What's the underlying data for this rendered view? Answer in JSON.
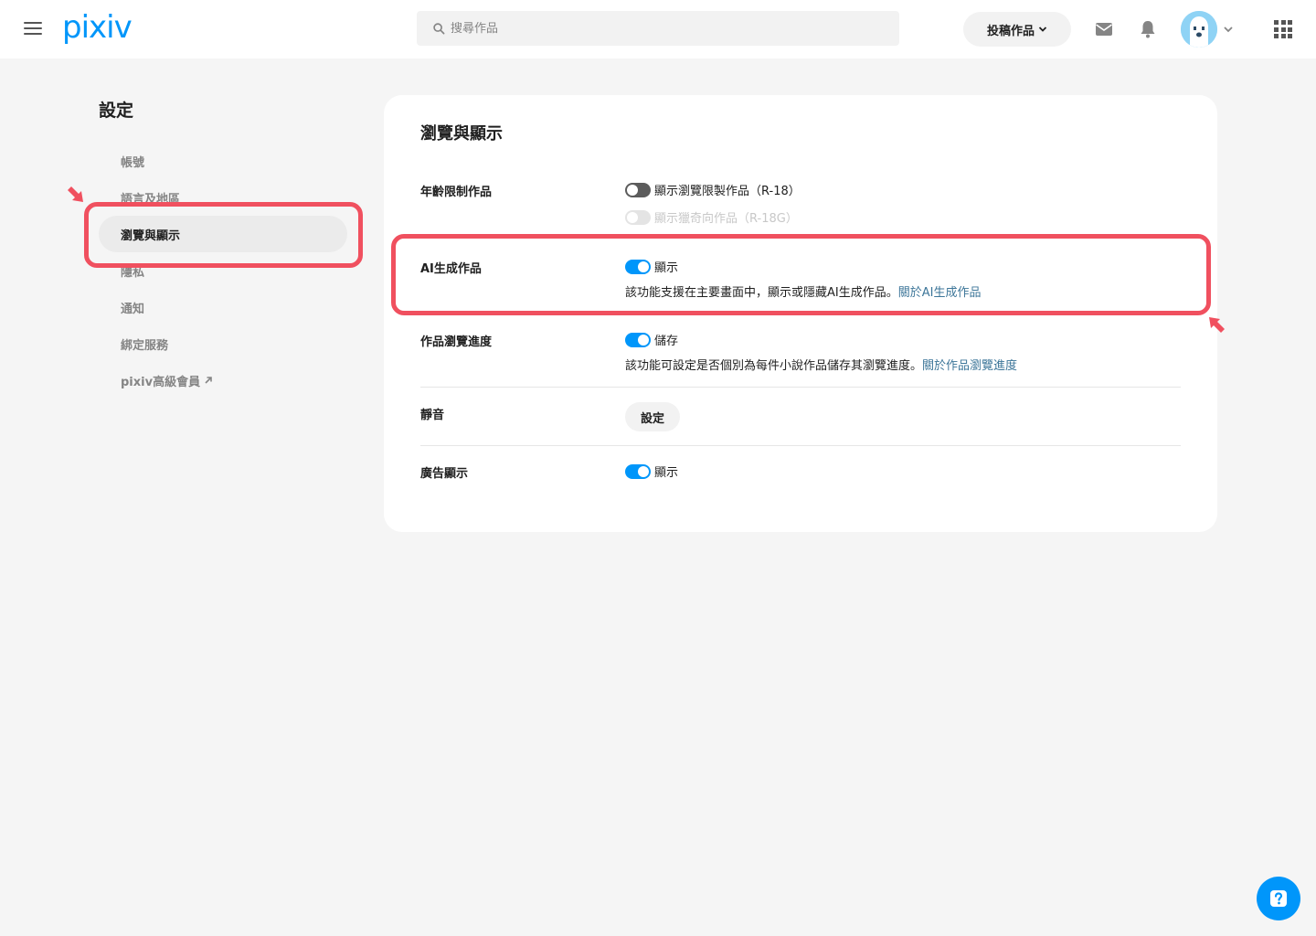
{
  "header": {
    "logo": "pixiv",
    "search_placeholder": "搜尋作品",
    "post_label": "投稿作品"
  },
  "sidebar": {
    "title": "設定",
    "items": [
      {
        "label": "帳號"
      },
      {
        "label": "語言及地區"
      },
      {
        "label": "瀏覽與顯示"
      },
      {
        "label": "隱私"
      },
      {
        "label": "通知"
      },
      {
        "label": "綁定服務"
      },
      {
        "label": "pixiv高級會員"
      }
    ]
  },
  "main": {
    "title": "瀏覽與顯示",
    "age": {
      "label": "年齡限制作品",
      "option1": "顯示瀏覽限製作品（R-18）",
      "option2": "顯示獵奇向作品（R-18G）"
    },
    "ai": {
      "label": "AI生成作品",
      "toggle_label": "顯示",
      "desc": "該功能支援在主要畫面中，顯示或隱藏AI生成作品。",
      "link": "關於AI生成作品"
    },
    "progress": {
      "label": "作品瀏覽進度",
      "toggle_label": "儲存",
      "desc": "該功能可設定是否個別為每件小說作品儲存其瀏覽進度。",
      "link": "關於作品瀏覽進度"
    },
    "mute": {
      "label": "靜音",
      "button": "設定"
    },
    "ads": {
      "label": "廣告顯示",
      "toggle_label": "顯示"
    }
  },
  "colors": {
    "accent": "#0096fa",
    "highlight": "#f0505f"
  }
}
